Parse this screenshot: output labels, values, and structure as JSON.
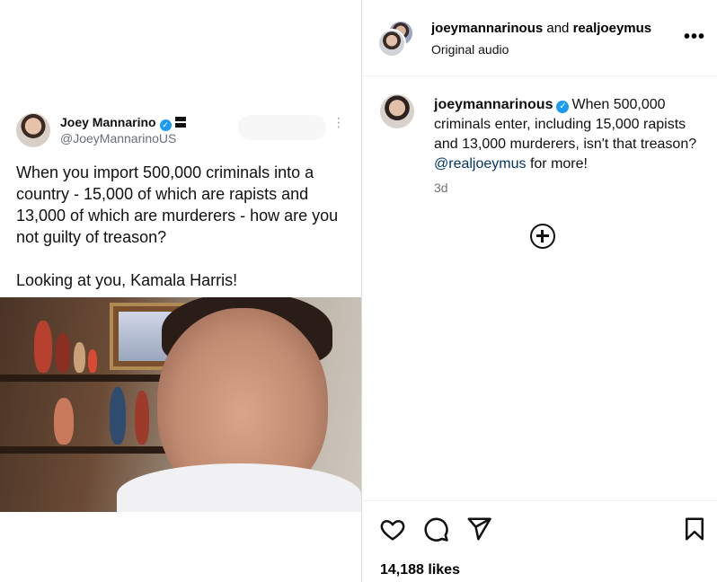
{
  "tweet": {
    "name": "Joey Mannarino",
    "verified_mark": "✓",
    "handle": "@JoeyMannarinoUS",
    "more": "⋮",
    "body_1": "When you import 500,000 criminals into a country - 15,000 of which are rapists and 13,000 of which are murderers - how are you not guilty of treason?",
    "body_2": "Looking at you, Kamala Harris!"
  },
  "header": {
    "user1": "joeymannarinous",
    "joiner": " and ",
    "user2": "realjoeymus",
    "audio": "Original audio",
    "more": "•••"
  },
  "post": {
    "username": "joeymannarinous",
    "verified_mark": "✓",
    "caption_text": "When 500,000 criminals enter, including 15,000 rapists and 13,000 murderers, isn't that treason? ",
    "mention": "@realjoeymus",
    "caption_tail": " for more!",
    "time_ago": "3d"
  },
  "actions": {
    "likes": "14,188 likes"
  },
  "icons": [
    "heart-icon",
    "comment-icon",
    "share-icon",
    "bookmark-icon",
    "add-circle-icon",
    "more-icon"
  ],
  "colors": {
    "verified": "#1d9bf0",
    "mention": "#00376b",
    "muted": "#737373"
  }
}
